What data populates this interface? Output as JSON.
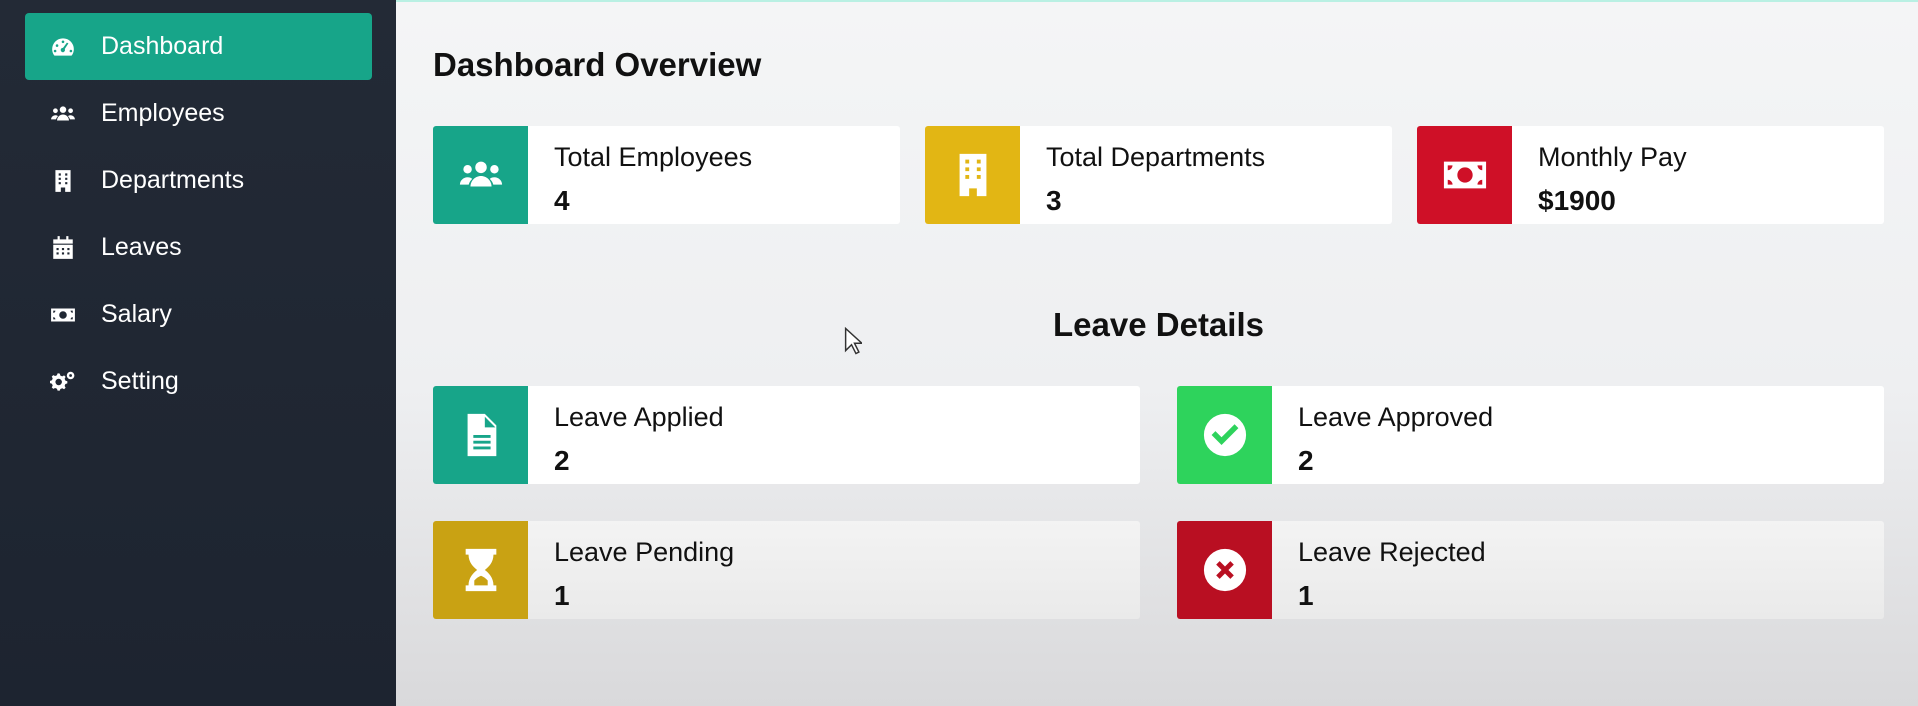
{
  "sidebar": {
    "items": [
      {
        "label": "Dashboard",
        "icon": "dashboard-gauge-icon",
        "active": true
      },
      {
        "label": "Employees",
        "icon": "users-icon",
        "active": false
      },
      {
        "label": "Departments",
        "icon": "building-icon",
        "active": false
      },
      {
        "label": "Leaves",
        "icon": "calendar-icon",
        "active": false
      },
      {
        "label": "Salary",
        "icon": "money-bill-icon",
        "active": false
      },
      {
        "label": "Setting",
        "icon": "cogs-icon",
        "active": false
      }
    ]
  },
  "main": {
    "title": "Dashboard Overview",
    "summary_cards": [
      {
        "label": "Total Employees",
        "value": "4",
        "icon": "users-icon",
        "color": "#17a589"
      },
      {
        "label": "Total Departments",
        "value": "3",
        "icon": "building-icon",
        "color": "#e2b614"
      },
      {
        "label": "Monthly Pay",
        "value": "$1900",
        "icon": "money-bill-icon",
        "color": "#cf1027"
      }
    ],
    "leave_section_title": "Leave Details",
    "leave_cards": [
      {
        "label": "Leave Applied",
        "value": "2",
        "icon": "file-icon",
        "color": "#17a589"
      },
      {
        "label": "Leave Approved",
        "value": "2",
        "icon": "check-circle-icon",
        "color": "#2ed35c"
      },
      {
        "label": "Leave Pending",
        "value": "1",
        "icon": "hourglass-icon",
        "color": "#c9a213"
      },
      {
        "label": "Leave Rejected",
        "value": "1",
        "icon": "times-circle-icon",
        "color": "#b90f22"
      }
    ]
  }
}
